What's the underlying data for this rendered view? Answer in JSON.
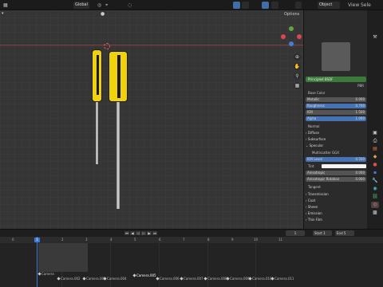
{
  "topbar": {
    "view_mode": "Global",
    "object_mode": "Object",
    "view_menu": "View",
    "select_menu": "Sele"
  },
  "viewport": {
    "options_label": "Options"
  },
  "props": {
    "material_name": "Principled BSDF",
    "pbr_value": "PBR",
    "base_color": "Base Color",
    "fields": [
      {
        "label": "Metallic",
        "value": "0.000"
      },
      {
        "label": "Roughness",
        "value": "0.700"
      },
      {
        "label": "IOR",
        "value": "1.500"
      },
      {
        "label": "Alpha",
        "value": "1.000"
      }
    ],
    "normal": "Normal",
    "sections": [
      "Diffuse",
      "Subsurface",
      "Specular"
    ],
    "distribution": "Multiscatter GGX",
    "ior_level": {
      "label": "IOR Level",
      "value": "0.500"
    },
    "tint": "Tint",
    "aniso": {
      "label": "Anisotropic",
      "value": "0.000"
    },
    "aniso_rot": {
      "label": "Anisotropic Rotation",
      "value": "0.000"
    },
    "tangent": "Tangent",
    "sections2": [
      "Transmission",
      "Coat",
      "Sheen",
      "Emission",
      "Thin Film"
    ]
  },
  "timeline": {
    "frame": "1",
    "ticks": [
      "0",
      "1",
      "2",
      "3",
      "4",
      "5",
      "6",
      "7",
      "8",
      "9",
      "10",
      "11"
    ],
    "current_frame": "1",
    "start_label": "Start",
    "start_value": "1",
    "end_label": "End",
    "end_value": "5",
    "markers": [
      "Camera",
      "Camera.002",
      "Camera.003",
      "Camera.004",
      "Camera.005",
      "Camera.006",
      "Camera.007",
      "Camera.008",
      "Camera.009",
      "Camera.010",
      "Camera.011",
      "Camera.012",
      "Camera.013"
    ]
  },
  "colors": {
    "accent": "#4772b3",
    "handle_yellow": "#f0d20a",
    "material_green": "#3c7a3c"
  },
  "icons": [
    "editor-type-icon",
    "overlay-icon",
    "gizmo-icon",
    "hand-icon",
    "zoom-icon",
    "camera-icon",
    "grid-icon",
    "tool-tab-icon",
    "render-tab-icon",
    "output-tab-icon",
    "view-layer-tab-icon",
    "scene-tab-icon",
    "world-tab-icon",
    "object-tab-icon",
    "modifier-tab-icon",
    "material-tab-icon"
  ]
}
